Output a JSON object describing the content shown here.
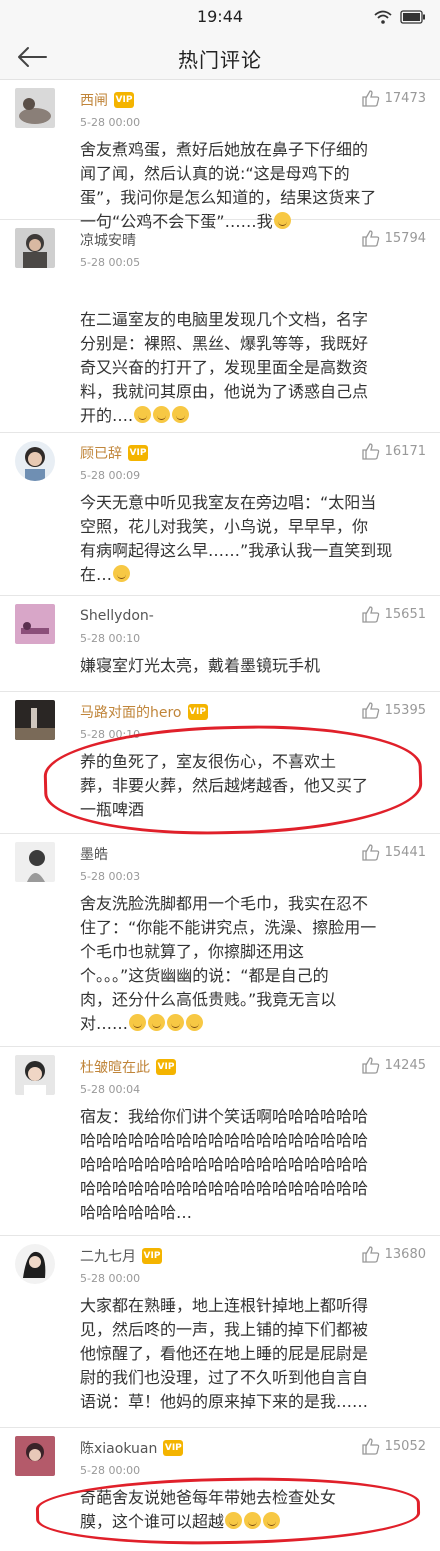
{
  "status": {
    "time": "19:44"
  },
  "header": {
    "title": "热门评论"
  },
  "comments": [
    {
      "username": "西闸",
      "vip": "VIP",
      "time": "5-28 00:00",
      "likes": "17473",
      "lines": [
        "舍友煮鸡蛋，煮好后她放在鼻子下仔细的",
        "闻了闻，然后认真的说:“这是母鸡下的",
        "蛋”，我问你是怎么知道的，结果这货来了",
        "一句“公鸡不会下蛋”……我"
      ]
    },
    {
      "username": "凉城安晴",
      "vip": "",
      "time": "5-28 00:05",
      "likes": "15794",
      "lines": [
        "在二逼室友的电脑里发现几个文档，名字",
        "分别是：裸照、黑丝、爆乳等等，我既好",
        "奇又兴奋的打开了，发现里面全是高数资",
        "料，我就问其原由，他说为了诱惑自己点",
        "开的…."
      ]
    },
    {
      "username": "顾已辞",
      "vip": "VIP",
      "time": "5-28 00:09",
      "likes": "16171",
      "lines": [
        "今天无意中听见我室友在旁边唱：“太阳当",
        "空照，花儿对我笑，小鸟说，早早早，你",
        "有病啊起得这么早……”我承认我一直笑到现",
        "在…"
      ]
    },
    {
      "username": "Shellydon-",
      "vip": "",
      "time": "5-28 00:10",
      "likes": "15651",
      "lines": [
        "嫌寝室灯光太亮，戴着墨镜玩手机"
      ]
    },
    {
      "username": "马路对面的hero",
      "vip": "VIP",
      "time": "5-28 00:10",
      "likes": "15395",
      "lines": [
        "养的鱼死了，室友很伤心，不喜欢土",
        "葬，非要火葬，然后越烤越香，他又买了",
        "一瓶啤酒"
      ]
    },
    {
      "username": "墨皓",
      "vip": "",
      "time": "5-28 00:03",
      "likes": "15441",
      "lines": [
        "舍友洗脸洗脚都用一个毛巾，我实在忍不",
        "住了：“你能不能讲究点，洗澡、擦脸用一",
        "个毛巾也就算了，你擦脚还用这",
        "个。。。”这货幽幽的说：“都是自己的",
        "肉，还分什么高低贵贱。”我竟无言以",
        "对……"
      ]
    },
    {
      "username": "杜皱暄在此",
      "vip": "VIP",
      "time": "5-28 00:04",
      "likes": "14245",
      "lines": [
        "宿友：我给你们讲个笑话啊哈哈哈哈哈哈",
        "哈哈哈哈哈哈哈哈哈哈哈哈哈哈哈哈哈哈",
        "哈哈哈哈哈哈哈哈哈哈哈哈哈哈哈哈哈哈",
        "哈哈哈哈哈哈哈哈哈哈哈哈哈哈哈哈哈哈",
        "哈哈哈哈哈哈…"
      ]
    },
    {
      "username": "二九七月",
      "vip": "VIP",
      "time": "5-28 00:00",
      "likes": "13680",
      "lines": [
        "大家都在熟睡，地上连根针掉地上都听得",
        "见，然后咚的一声，我上铺的掉下们都被",
        "他惊醒了，看他还在地上睡的屁是屁尉是",
        "尉的我们也没理，过了不久听到他自言自",
        "语说：草！他妈的原来掉下来的是我……"
      ]
    },
    {
      "username": "陈xiaokuan",
      "vip": "VIP",
      "time": "5-28 00:00",
      "likes": "15052",
      "lines": [
        "奇葩舍友说她爸每年带她去检查处女",
        "膜，这个谁可以超越"
      ]
    }
  ]
}
